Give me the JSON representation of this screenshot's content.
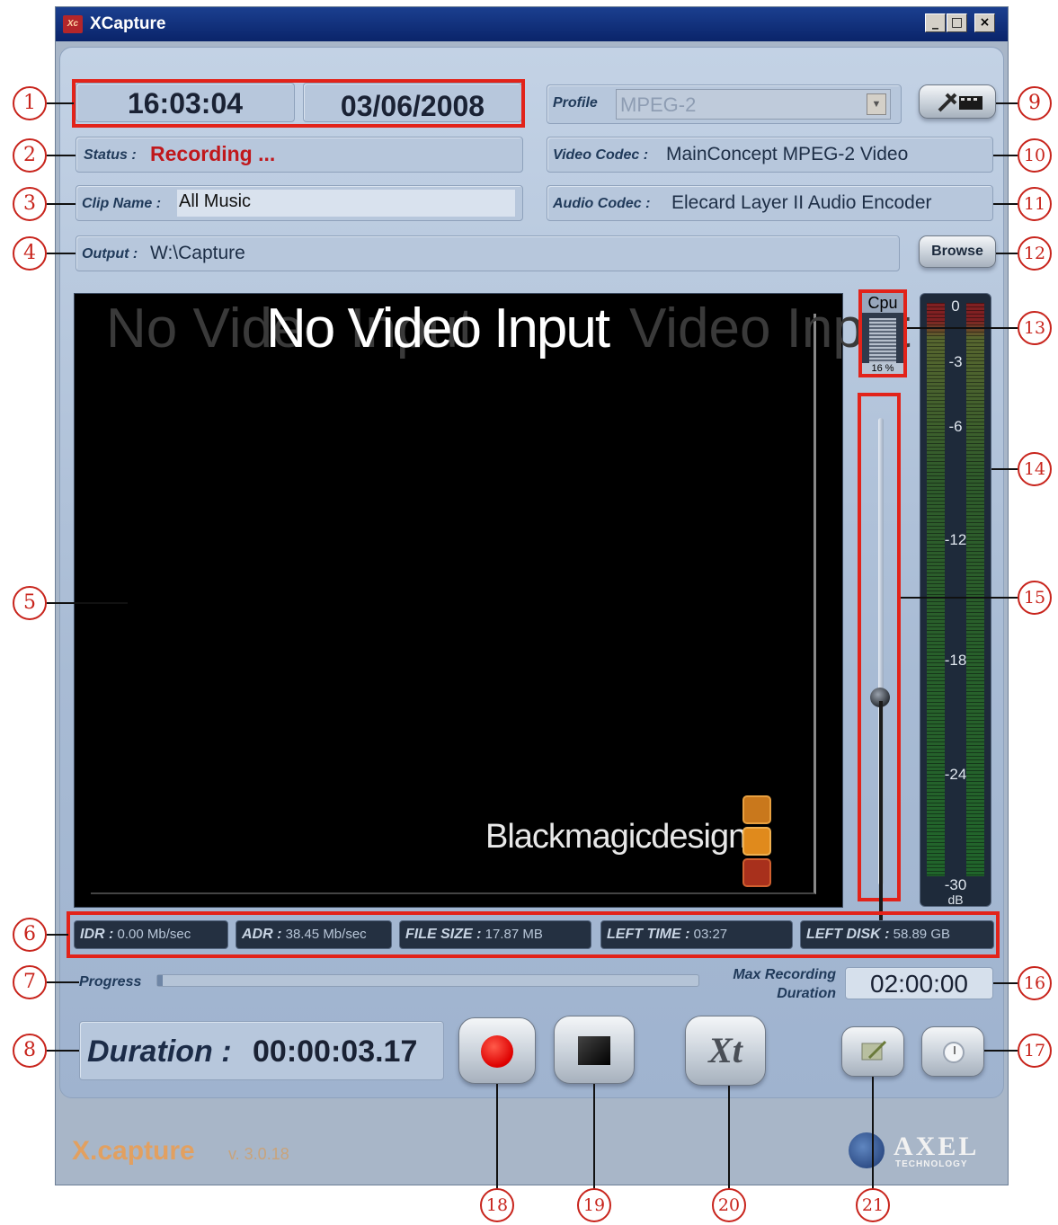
{
  "window": {
    "title": "XCapture",
    "app_icon": "Xc",
    "minimize": "_",
    "maximize": "□",
    "close": "×"
  },
  "clock": {
    "time": "16:03:04",
    "date": "03/06/2008"
  },
  "profile": {
    "label": "Profile",
    "value": "MPEG-2",
    "settings_icon": "tools-icon"
  },
  "status": {
    "label": "Status :",
    "value": "Recording ...",
    "color": "#c0181c"
  },
  "video_codec": {
    "label": "Video Codec :",
    "value": "MainConcept MPEG-2 Video"
  },
  "clip": {
    "label": "Clip Name :",
    "value": "All Music"
  },
  "audio_codec": {
    "label": "Audio Codec :",
    "value": "Elecard Layer II Audio Encoder"
  },
  "output": {
    "label": "Output :",
    "value": "W:\\Capture",
    "browse": "Browse"
  },
  "video": {
    "message": "No Video Input",
    "ghost_left": "No Video Input",
    "ghost_right": "Video Input",
    "brand": "Blackmagicdesign"
  },
  "cpu": {
    "label": "Cpu",
    "percent": "16 %"
  },
  "vu": {
    "ticks": [
      "0",
      "-3",
      "-6",
      "-12",
      "-18",
      "-24",
      "-30"
    ],
    "unit": "dB"
  },
  "stats": [
    {
      "label": "IDR :",
      "value": "0.00 Mb/sec"
    },
    {
      "label": "ADR :",
      "value": "38.45 Mb/sec"
    },
    {
      "label": "FILE SIZE :",
      "value": "17.87 MB"
    },
    {
      "label": "LEFT TIME :",
      "value": "03:27"
    },
    {
      "label": "LEFT DISK :",
      "value": "58.89 GB"
    }
  ],
  "progress": {
    "label": "Progress",
    "fraction": 0.01
  },
  "max_duration": {
    "label_line1": "Max Recording",
    "label_line2": "Duration",
    "value": "02:00:00"
  },
  "duration": {
    "label": "Duration :",
    "value": "00:00:03.17"
  },
  "controls": {
    "xt_label": "Xt"
  },
  "footer": {
    "brand": "X.capture",
    "version": "v. 3.0.18",
    "company": "AXEL",
    "company_sub": "TECHNOLOGY"
  },
  "callouts": [
    "1",
    "2",
    "3",
    "4",
    "5",
    "6",
    "7",
    "8",
    "9",
    "10",
    "11",
    "12",
    "13",
    "14",
    "15",
    "16",
    "17",
    "18",
    "19",
    "20",
    "21"
  ],
  "colors": {
    "accent_red": "#e2231a",
    "panel": "#b7c7dc",
    "record": "#e01010"
  }
}
